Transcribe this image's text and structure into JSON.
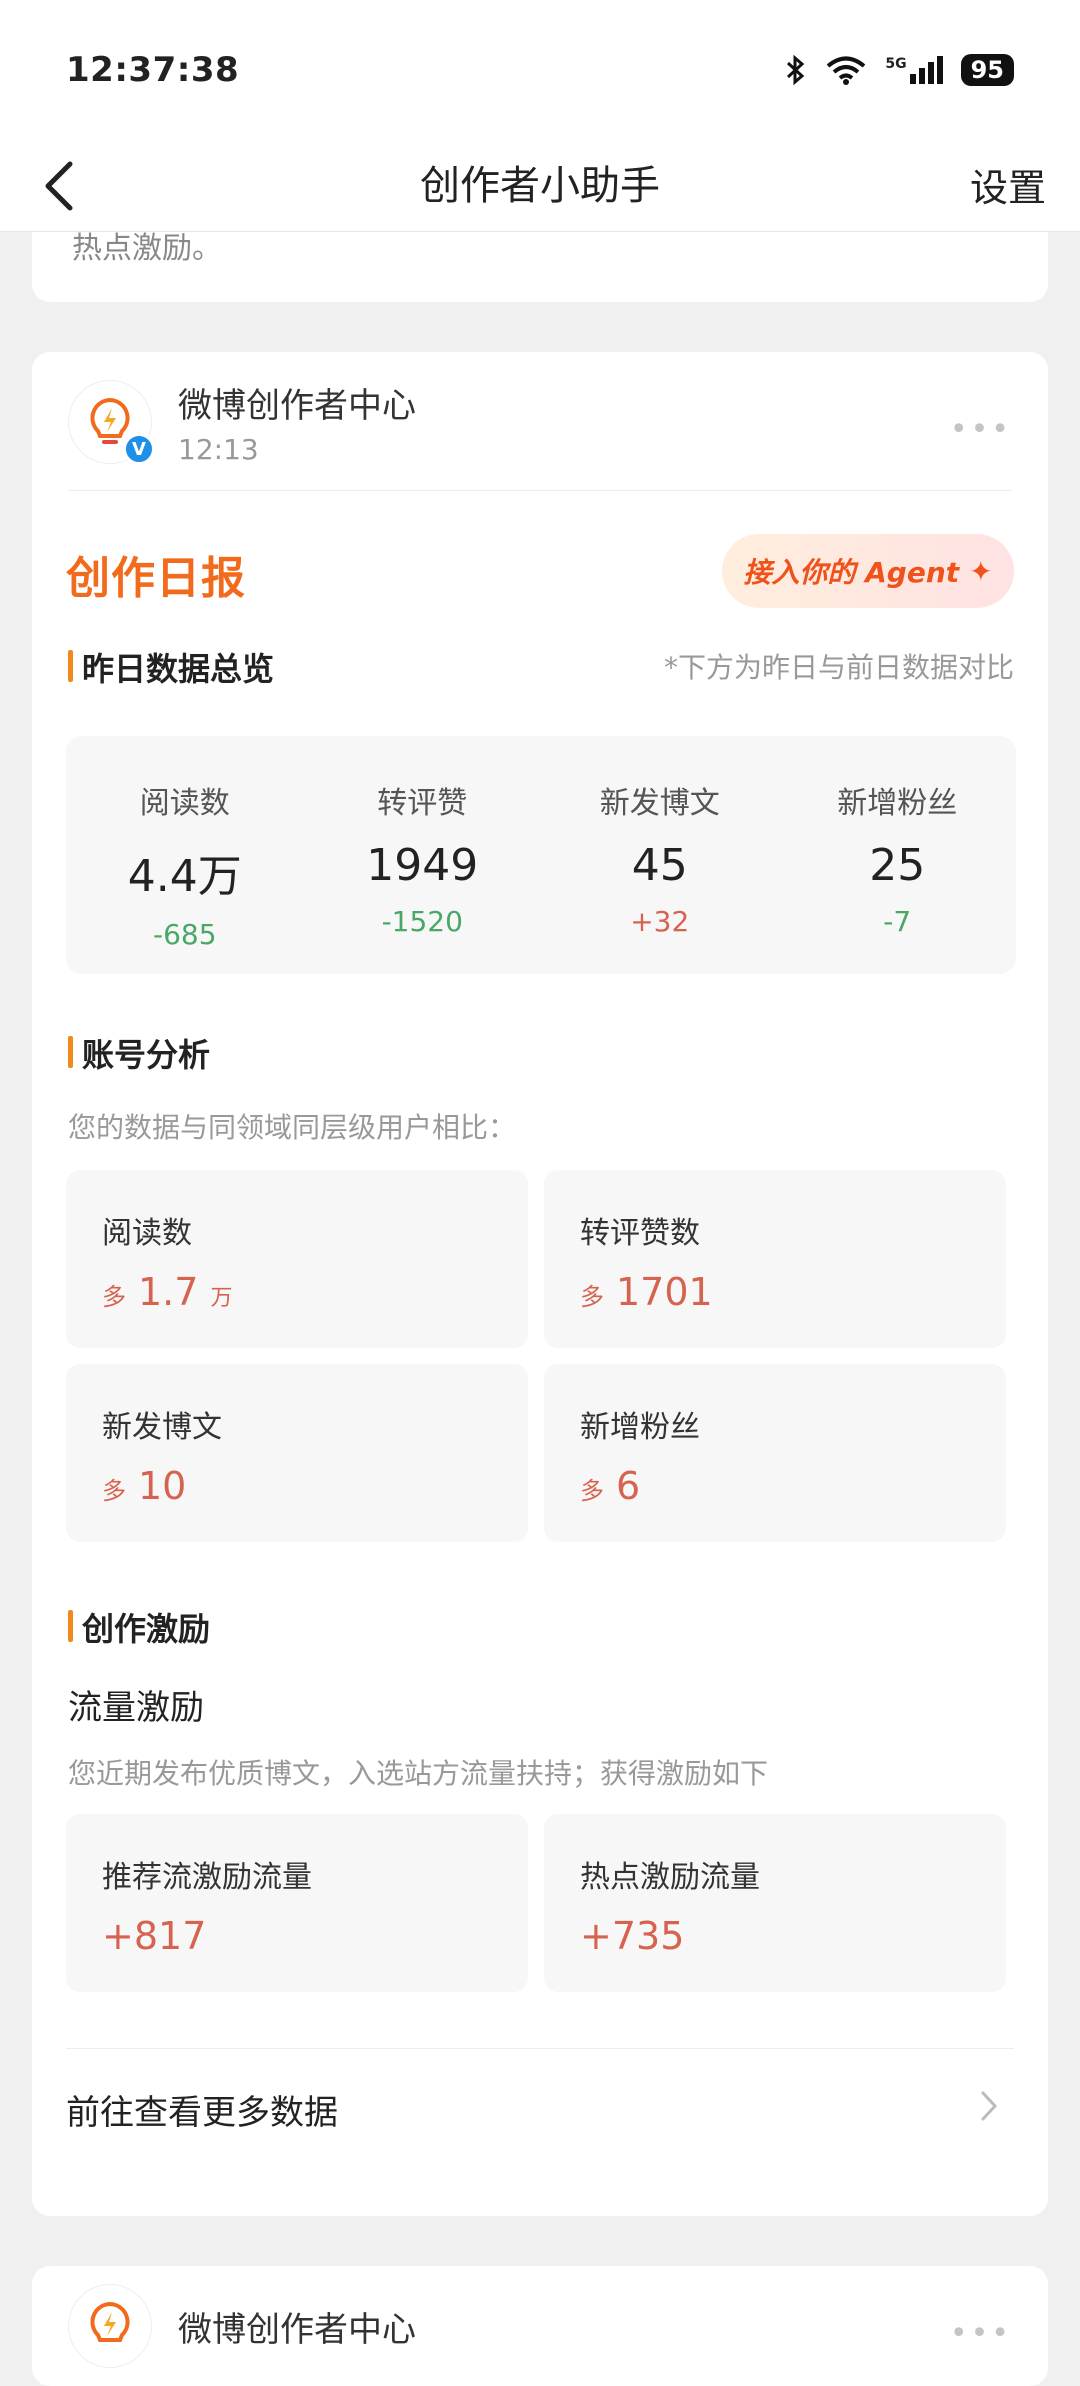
{
  "status": {
    "time": "12:37:38",
    "battery": "95",
    "network": "5G"
  },
  "nav": {
    "title": "创作者小助手",
    "settings": "设置"
  },
  "prev_card": {
    "tail_text": "热点激励。"
  },
  "post": {
    "author": "微博创作者中心",
    "time": "12:13",
    "report_title": "创作日报",
    "agent_button": "接入你的 Agent",
    "yesterday": {
      "title": "昨日数据总览",
      "note": "*下方为昨日与前日数据对比",
      "metrics": [
        {
          "label": "阅读数",
          "value": "4.4万",
          "delta": "-685",
          "trend": "down"
        },
        {
          "label": "转评赞",
          "value": "1949",
          "delta": "-1520",
          "trend": "down"
        },
        {
          "label": "新发博文",
          "value": "45",
          "delta": "+32",
          "trend": "up"
        },
        {
          "label": "新增粉丝",
          "value": "25",
          "delta": "-7",
          "trend": "down"
        }
      ]
    },
    "analysis": {
      "title": "账号分析",
      "desc": "您的数据与同领域同层级用户相比：",
      "items": [
        {
          "label": "阅读数",
          "prefix": "多",
          "value": "1.7",
          "unit": "万"
        },
        {
          "label": "转评赞数",
          "prefix": "多",
          "value": "1701",
          "unit": ""
        },
        {
          "label": "新发博文",
          "prefix": "多",
          "value": "10",
          "unit": ""
        },
        {
          "label": "新增粉丝",
          "prefix": "多",
          "value": "6",
          "unit": ""
        }
      ]
    },
    "incentive": {
      "title": "创作激励",
      "subtitle": "流量激励",
      "desc": "您近期发布优质博文，入选站方流量扶持；获得激励如下",
      "items": [
        {
          "label": "推荐流激励流量",
          "value": "+817"
        },
        {
          "label": "热点激励流量",
          "value": "+735"
        }
      ]
    },
    "more_link": "前往查看更多数据"
  },
  "next_post": {
    "author": "微博创作者中心"
  },
  "colors": {
    "accent": "#f26a1b",
    "up": "#d6634f",
    "down": "#4aa866"
  }
}
